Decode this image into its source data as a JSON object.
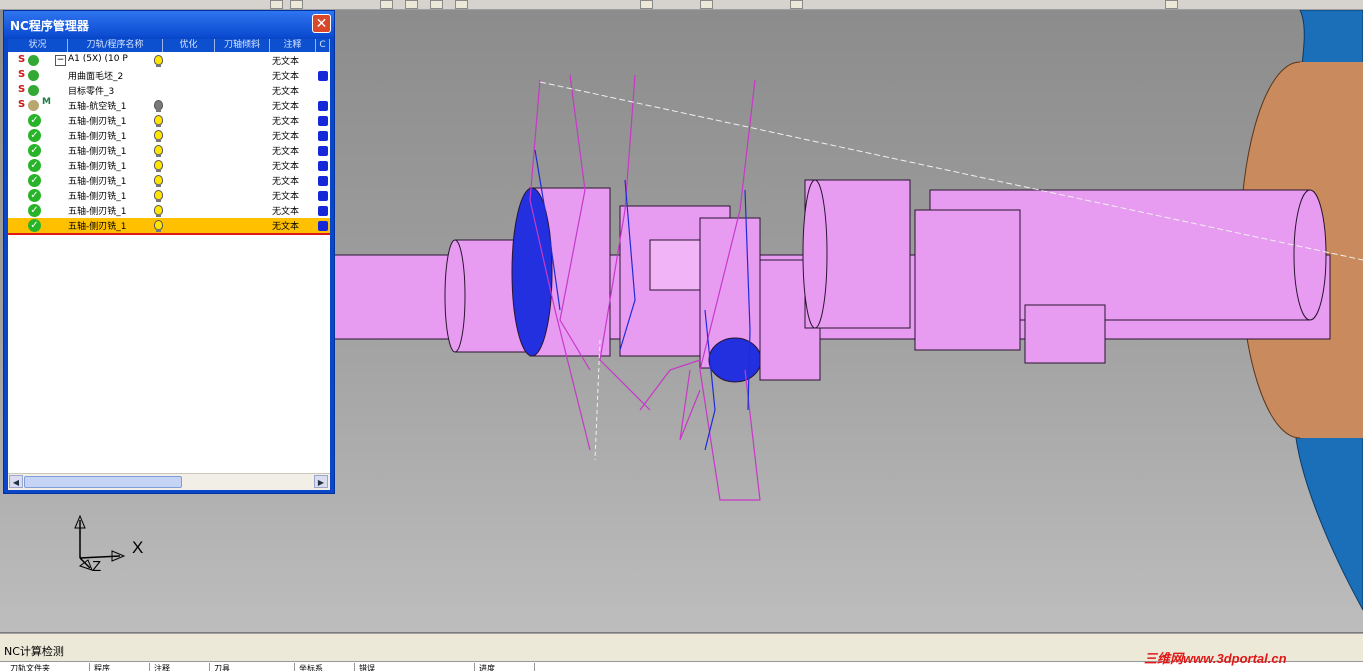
{
  "window": {
    "title": "NC程序管理器",
    "close_label": "✕"
  },
  "columns": [
    "状况",
    "刀轨/程序名称",
    "优化",
    "刀轴倾斜",
    "注释",
    "C"
  ],
  "rows": [
    {
      "status": "S",
      "icon": "power-green",
      "toggle": "−",
      "name": "A1 (5X) (10 P",
      "bulb": "yellow",
      "note": "无文本",
      "cbox": false
    },
    {
      "status": "S",
      "icon": "power-green",
      "name": "用曲面毛坯_2",
      "bulb": "",
      "note": "无文本",
      "cbox": true
    },
    {
      "status": "S",
      "icon": "power-green",
      "name": "目标零件_3",
      "bulb": "",
      "note": "无文本",
      "cbox": false
    },
    {
      "status": "S",
      "icon": "power-gray",
      "flag": "M",
      "name": "五轴-航空铣_1",
      "bulb": "gray",
      "note": "无文本",
      "cbox": true
    },
    {
      "status": "",
      "icon": "check",
      "name": "五轴-侧刃铣_1",
      "bulb": "yellow",
      "note": "无文本",
      "cbox": true
    },
    {
      "status": "",
      "icon": "check",
      "name": "五轴-侧刃铣_1",
      "bulb": "yellow",
      "note": "无文本",
      "cbox": true
    },
    {
      "status": "",
      "icon": "check",
      "name": "五轴-侧刃铣_1",
      "bulb": "yellow",
      "note": "无文本",
      "cbox": true
    },
    {
      "status": "",
      "icon": "check",
      "name": "五轴-侧刃铣_1",
      "bulb": "yellow",
      "note": "无文本",
      "cbox": true
    },
    {
      "status": "",
      "icon": "check",
      "name": "五轴-侧刃铣_1",
      "bulb": "yellow",
      "note": "无文本",
      "cbox": true
    },
    {
      "status": "",
      "icon": "check",
      "name": "五轴-侧刃铣_1",
      "bulb": "yellow",
      "note": "无文本",
      "cbox": true
    },
    {
      "status": "",
      "icon": "check",
      "name": "五轴-侧刃铣_1",
      "bulb": "yellow",
      "note": "无文本",
      "cbox": true
    },
    {
      "status": "",
      "icon": "check",
      "name": "五轴-侧刃铣_1",
      "bulb": "yellow",
      "note": "无文本",
      "cbox": true,
      "selected": true
    }
  ],
  "axes": {
    "x": "X",
    "z": "Z"
  },
  "bottom": {
    "title": "NC计算检测",
    "columns": [
      "刀轨文件夹",
      "程序",
      "注释",
      "刀具",
      "坐标系",
      "错误",
      "进度"
    ]
  },
  "watermark": "三维网www.3dportal.cn",
  "colors": {
    "part": "#e79cf2",
    "part_edge": "#2a1430",
    "stock_face": "#c98a5e",
    "chuck": "#1a6fb8",
    "toolpath": "#c838c8",
    "toolpath_blue": "#1e2cd8"
  }
}
